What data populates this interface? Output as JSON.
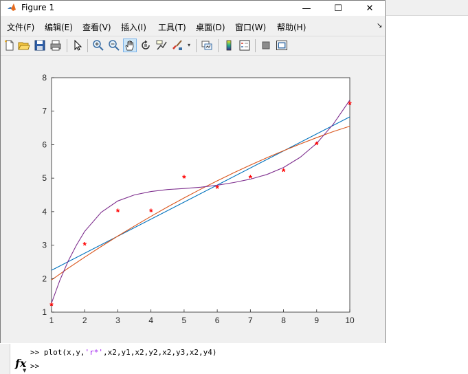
{
  "window": {
    "title": "Figure 1"
  },
  "window_controls": {
    "minimize": "—",
    "maximize": "☐",
    "close": "✕"
  },
  "menu": [
    "文件(F)",
    "编辑(E)",
    "查看(V)",
    "插入(I)",
    "工具(T)",
    "桌面(D)",
    "窗口(W)",
    "帮助(H)"
  ],
  "menu_corner": "↘",
  "toolbar": {
    "buttons": [
      "new-figure-icon",
      "open-file-icon",
      "save-icon",
      "print-icon",
      "pointer-icon",
      "zoom-in-icon",
      "zoom-out-icon",
      "pan-hand-icon",
      "rotate-3d-icon",
      "data-cursor-icon",
      "brush-icon",
      "link-plot-icon",
      "colorbar-icon",
      "legend-icon",
      "hide-plot-tools-icon",
      "show-plot-tools-icon"
    ],
    "active": "pan-hand-icon"
  },
  "command_window": {
    "prompt": ">>",
    "command_prefix": "plot(x,y,",
    "command_string": "'r*'",
    "command_suffix": ",x2,y1,x2,y2,x2,y3,x2,y4)",
    "fx_label": "fx"
  },
  "colors": {
    "data_points": "#ff0000",
    "series_1": "#0072bd",
    "series_2": "#d95319",
    "series_3": "#7e2f8e",
    "axes_background": "#ffffff",
    "figure_background": "#f0f0f0"
  },
  "chart_data": {
    "type": "line",
    "title": "",
    "xlabel": "",
    "ylabel": "",
    "xlim": [
      1,
      10
    ],
    "ylim": [
      1,
      8
    ],
    "xticks": [
      1,
      2,
      3,
      4,
      5,
      6,
      7,
      8,
      9,
      10
    ],
    "yticks": [
      1,
      2,
      3,
      4,
      5,
      6,
      7,
      8
    ],
    "grid": false,
    "legend": "none",
    "scatter": {
      "marker": "*",
      "x": [
        1,
        2,
        3,
        4,
        5,
        6,
        7,
        8,
        9,
        10
      ],
      "y": [
        1.2,
        3.0,
        4.0,
        4.0,
        5.0,
        4.7,
        5.0,
        5.2,
        6.0,
        7.2
      ]
    },
    "series": [
      {
        "x": [
          1,
          10
        ],
        "y": [
          2.25,
          6.83
        ]
      },
      {
        "x": [
          1,
          1.5,
          2,
          2.5,
          3,
          3.5,
          4,
          4.5,
          5,
          5.5,
          6,
          6.5,
          7,
          7.5,
          8,
          8.5,
          9,
          9.5,
          10
        ],
        "y": [
          1.96,
          2.31,
          2.64,
          2.96,
          3.27,
          3.57,
          3.86,
          4.14,
          4.41,
          4.67,
          4.92,
          5.16,
          5.39,
          5.61,
          5.82,
          6.02,
          6.21,
          6.39,
          6.55
        ]
      },
      {
        "x": [
          1,
          1.25,
          1.5,
          1.75,
          2,
          2.5,
          3,
          3.5,
          4,
          4.5,
          5,
          5.5,
          6,
          6.5,
          7,
          7.5,
          8,
          8.5,
          9,
          9.5,
          10
        ],
        "y": [
          1.27,
          1.95,
          2.52,
          3.0,
          3.41,
          3.98,
          4.32,
          4.5,
          4.6,
          4.66,
          4.69,
          4.73,
          4.79,
          4.87,
          4.97,
          5.11,
          5.32,
          5.62,
          6.04,
          6.61,
          7.33
        ]
      }
    ]
  }
}
